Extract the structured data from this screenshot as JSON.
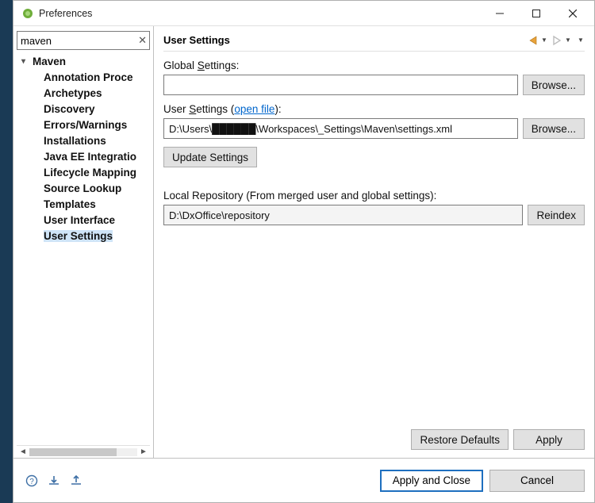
{
  "window": {
    "title": "Preferences"
  },
  "search": {
    "value": "maven"
  },
  "tree": {
    "root": "Maven",
    "children": [
      "Annotation Proce",
      "Archetypes",
      "Discovery",
      "Errors/Warnings",
      "Installations",
      "Java EE Integratio",
      "Lifecycle Mapping",
      "Source Lookup",
      "Templates",
      "User Interface",
      "User Settings"
    ],
    "selected": "User Settings"
  },
  "page": {
    "title": "User Settings",
    "global_label_prefix": "Global ",
    "global_label_u": "S",
    "global_label_suffix": "ettings:",
    "global_value": "",
    "browse1": "Browse...",
    "user_label_prefix": "User ",
    "user_label_u": "S",
    "user_label_suffix": "ettings (",
    "open_file": "open file",
    "user_label_close": "):",
    "user_value": "D:\\Users\\██████\\Workspaces\\_Settings\\Maven\\settings.xml",
    "browse2": "Browse...",
    "update_btn": "Update Settings",
    "local_repo_label": "Local Repository (From merged user and global settings):",
    "local_repo_value": "D:\\DxOffice\\repository",
    "reindex": "Reindex",
    "restore": "Restore Defaults",
    "apply": "Apply"
  },
  "footer": {
    "apply_close": "Apply and Close",
    "cancel": "Cancel"
  }
}
